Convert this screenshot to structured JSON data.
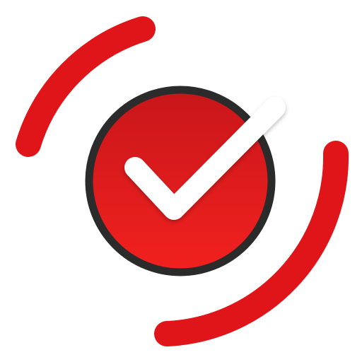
{
  "icon": {
    "name": "red-circle-checkmark-icon",
    "colors": {
      "arc": "#E01519",
      "disc_top": "#C8161A",
      "disc_bottom": "#F2211F",
      "disc_border": "#2B2B2B",
      "check": "#FFFFFF",
      "background": "#FFFFFF"
    }
  }
}
